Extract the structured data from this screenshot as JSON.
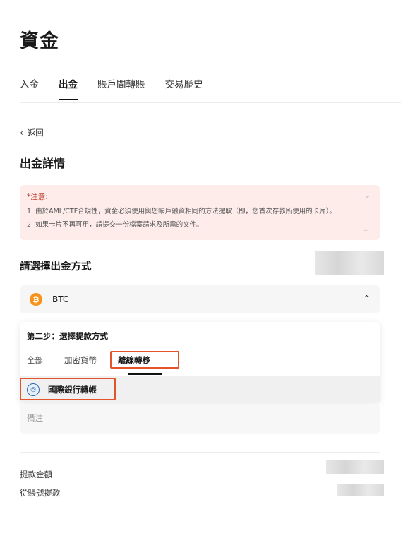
{
  "page": {
    "title": "資金"
  },
  "tabs": [
    {
      "label": "入金"
    },
    {
      "label": "出金"
    },
    {
      "label": "賬戶間轉賬"
    },
    {
      "label": "交易歷史"
    }
  ],
  "back": {
    "label": "返回"
  },
  "section_title": "出金詳情",
  "notice": {
    "head": "*注意:",
    "lines": [
      "1. 由於AML/CTF合規性，資金必須使用與您帳戶融資相同的方法提取（即，您首次存款所使用的卡片）。",
      "2. 如果卡片不再可用，請提交一份檔案請求及所需的文件。"
    ],
    "more": "..."
  },
  "method": {
    "title": "請選擇出金方式",
    "coin": {
      "label": "BTC",
      "icon": "bitcoin-icon"
    },
    "step_title": "第二步：選擇提款方式",
    "tabs": [
      {
        "label": "全部"
      },
      {
        "label": "加密貨幣"
      },
      {
        "label": "離線轉移"
      }
    ],
    "option": {
      "label": "國際銀行轉帳",
      "icon": "bank-icon"
    },
    "remark_placeholder": "備注"
  },
  "summary": {
    "amount_label": "提款金額",
    "account_label": "從賬號提款"
  },
  "colors": {
    "highlight": "#e2542a",
    "notice_bg": "#fdecea",
    "btc": "#f7931a"
  }
}
